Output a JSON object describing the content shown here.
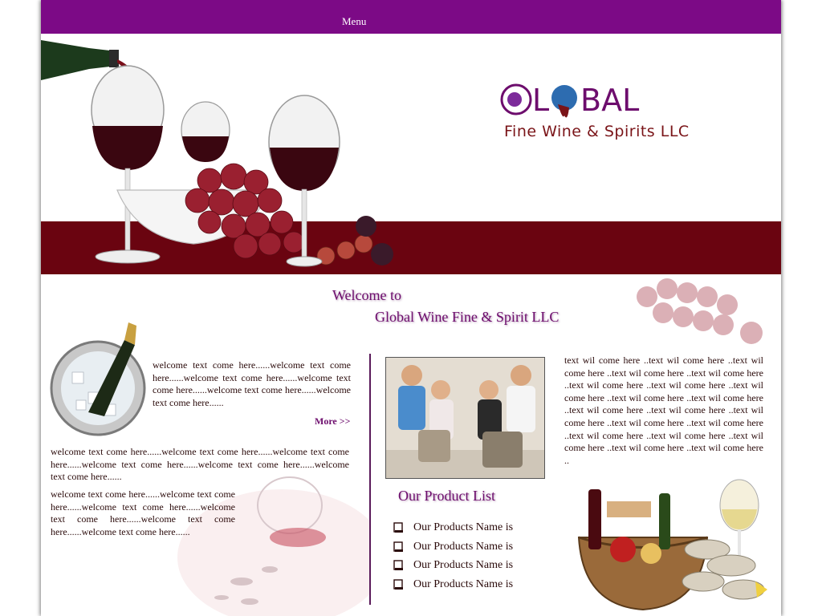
{
  "menu": {
    "label": "Menu"
  },
  "logo": {
    "main": "GLOBAL",
    "sub": "Fine Wine  & Spirits LLC"
  },
  "welcome": {
    "line1": "Welcome to",
    "line2": "Global Wine Fine & Spirit LLC"
  },
  "intro": {
    "paragraph1": "welcome text come here......welcome text come here......welcome text come here......welcome text come here......welcome text come here......welcome text come here......",
    "more_label": "More >>",
    "paragraph2": "welcome text come here......welcome text come here......welcome text come here......welcome text come here......welcome text come here......welcome text come here......",
    "paragraph3": "welcome text come here......welcome text come here......welcome text come here......welcome text come here......welcome text come here......welcome text come here......"
  },
  "products": {
    "title": "Our Product List",
    "items": [
      {
        "label": "Our Products Name is"
      },
      {
        "label": "Our Products Name is"
      },
      {
        "label": "Our Products Name is"
      },
      {
        "label": "Our Products Name is"
      }
    ]
  },
  "right_text": "text wil come here ..text wil come here ..text wil come here ..text wil come here ..text wil come here ..text wil come here ..text wil come here ..text wil come here ..text wil come here ..text wil come here ..text wil come here ..text wil come here ..text wil come here ..text wil come here ..text wil come here ..text wil come here ..text wil come here ..text wil come here ..text wil come here ..text wil come here ..",
  "colors": {
    "menu_bar": "#7c0a86",
    "wine_band": "#6a0410",
    "heading": "#6d0d6d"
  }
}
